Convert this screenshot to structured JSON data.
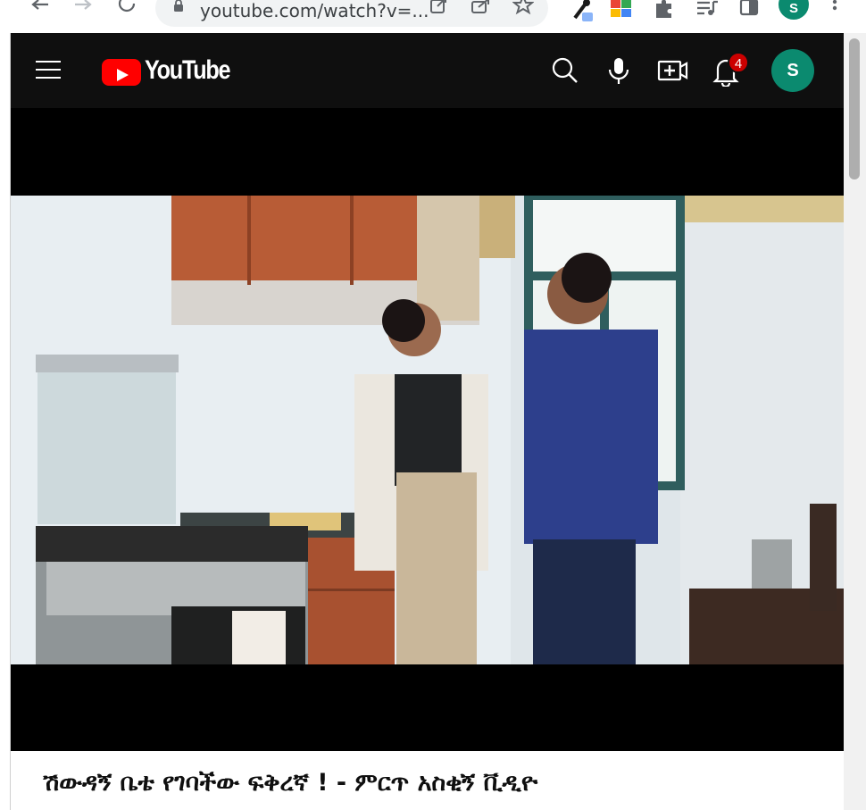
{
  "browser": {
    "url": "youtube.com/watch?v=...",
    "profile_initial": "S"
  },
  "youtube": {
    "logo_text": "YouTube",
    "notification_count": "4",
    "avatar_initial": "S",
    "icons": {
      "menu": "hamburger-menu-icon",
      "search": "search-icon",
      "voice": "microphone-icon",
      "create": "video-create-icon",
      "notifications": "bell-icon"
    }
  },
  "video": {
    "title": "ሽውዳኝ ቤቴ የገባችው ፍቅረኛ ! - ምርጥ አስቂኝ ቪዲዮ"
  },
  "colors": {
    "brand_red": "#ff0000",
    "header_bg": "#0f0f0f",
    "avatar_bg": "#0b8a6f",
    "badge_red": "#cc0000"
  }
}
